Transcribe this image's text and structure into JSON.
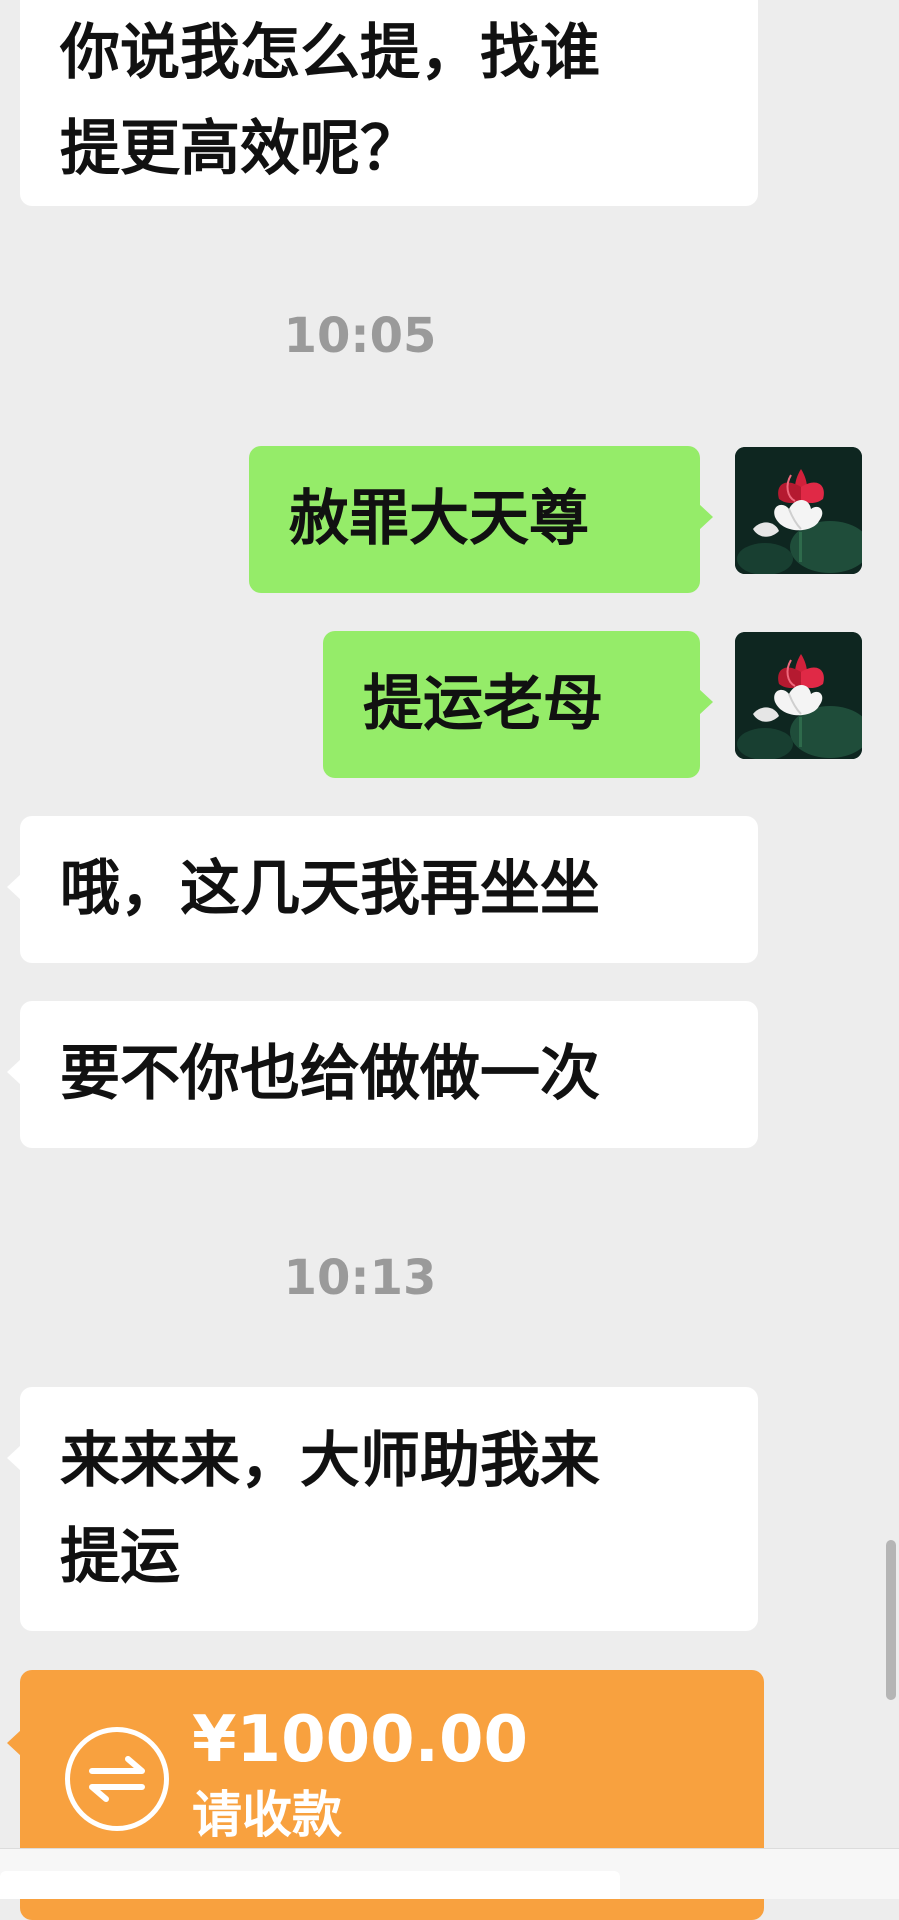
{
  "messages": [
    {
      "side": "left",
      "lines": [
        "你说我怎么提，找谁",
        "提更高效呢？"
      ]
    },
    {
      "type": "time",
      "text": "10:05"
    },
    {
      "side": "right",
      "text": "赦罪大天尊"
    },
    {
      "side": "right",
      "text": "提运老母"
    },
    {
      "side": "left",
      "text": "哦，这几天我再坐坐"
    },
    {
      "side": "left",
      "text": "要不你也给做做一次"
    },
    {
      "type": "time",
      "text": "10:13"
    },
    {
      "side": "left",
      "lines": [
        "来来来，大师助我来",
        "提运"
      ]
    }
  ],
  "transfer": {
    "amount": "¥1000.00",
    "description": "请收款",
    "icon": "transfer-arrows-icon",
    "color": "#f8a13f"
  },
  "avatar": {
    "icon": "lotus-avatar-icon"
  },
  "colors": {
    "background": "#ededed",
    "incoming_bubble": "#ffffff",
    "outgoing_bubble": "#95ec69",
    "time_text": "#9a9a9a"
  }
}
